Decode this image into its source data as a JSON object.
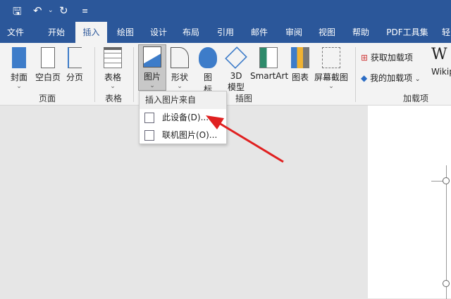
{
  "qat": {
    "save": "save-icon",
    "undo": "undo-icon",
    "redo": "redo-icon",
    "more": "customize-icon"
  },
  "tabs": [
    "文件",
    "开始",
    "插入",
    "绘图",
    "设计",
    "布局",
    "引用",
    "邮件",
    "审阅",
    "视图",
    "帮助",
    "PDF工具集",
    "轻"
  ],
  "active_tab": "插入",
  "ribbon": {
    "buttons": {
      "cover": "封面",
      "blank": "空白页",
      "break": "分页",
      "table": "表格",
      "picture": "图片",
      "shapes": "形状",
      "icons_1": "图",
      "icons_2": "标",
      "model_1": "3D",
      "model_2": "模型",
      "smartart": "SmartArt",
      "chart": "图表",
      "screenshot": "屏幕截图",
      "get_addins": "获取加载项",
      "my_addins": "我的加载项",
      "wiki": "Wikip"
    },
    "groups": {
      "pages": "页面",
      "tables": "表格",
      "illustrations": "插图",
      "addins": "加载项"
    }
  },
  "menu": {
    "header": "插入图片来自",
    "items": [
      "此设备(D)...",
      "联机图片(O)..."
    ]
  },
  "colors": {
    "accent": "#2b579a",
    "arrow": "#e02020"
  }
}
